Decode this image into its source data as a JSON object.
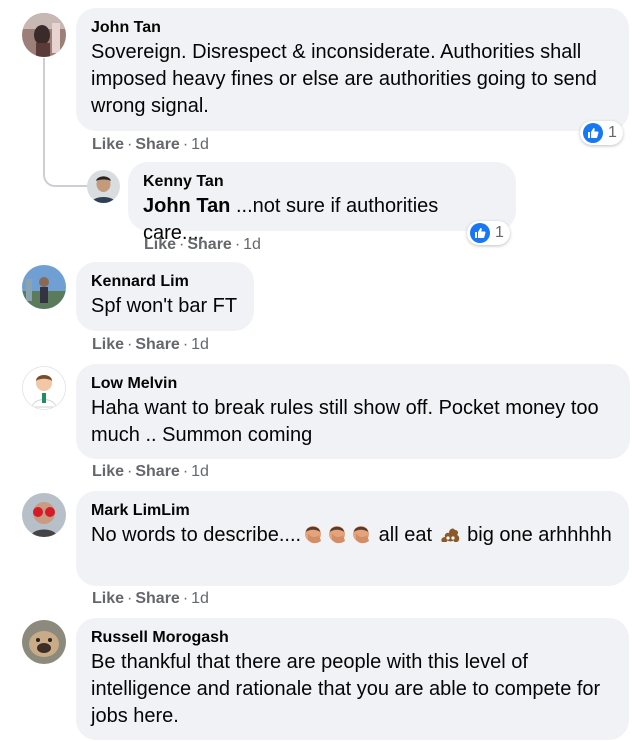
{
  "labels": {
    "like": "Like",
    "share": "Share",
    "sep": "·"
  },
  "colors": {
    "bubble": "#f0f2f5",
    "meta": "#65676b",
    "like_blue": "#1877f2"
  },
  "comments": [
    {
      "author": "John Tan",
      "text": "Sovereign. Disrespect & inconsiderate. Authorities shall imposed heavy fines or else are authorities going to send wrong signal.",
      "time": "1d",
      "reaction_icon": "like-icon",
      "reaction_count": "1",
      "replies": [
        {
          "author": "Kenny Tan",
          "mention": "John Tan",
          "text": " ...not sure if authorities care....",
          "time": "1d",
          "reaction_icon": "like-icon",
          "reaction_count": "1"
        }
      ]
    },
    {
      "author": "Kennard Lim",
      "text": "Spf won't bar FT",
      "time": "1d"
    },
    {
      "author": "Low Melvin",
      "text": "Haha want to break rules still show off. Pocket money too much .. Summon coming",
      "time": "1d"
    },
    {
      "author": "Mark LimLim",
      "text_before": "No words to describe....",
      "text_middle": " all eat ",
      "text_after": " big one arhhhhh",
      "emoji_icons": [
        "person-facepalming-icon",
        "person-facepalming-icon",
        "person-facepalming-icon",
        "pile-of-poo-icon"
      ],
      "time": "1d"
    },
    {
      "author": "Russell Morogash",
      "text": "Be thankful that there are people with this level of intelligence and rationale that you are able to compete for jobs here."
    }
  ]
}
